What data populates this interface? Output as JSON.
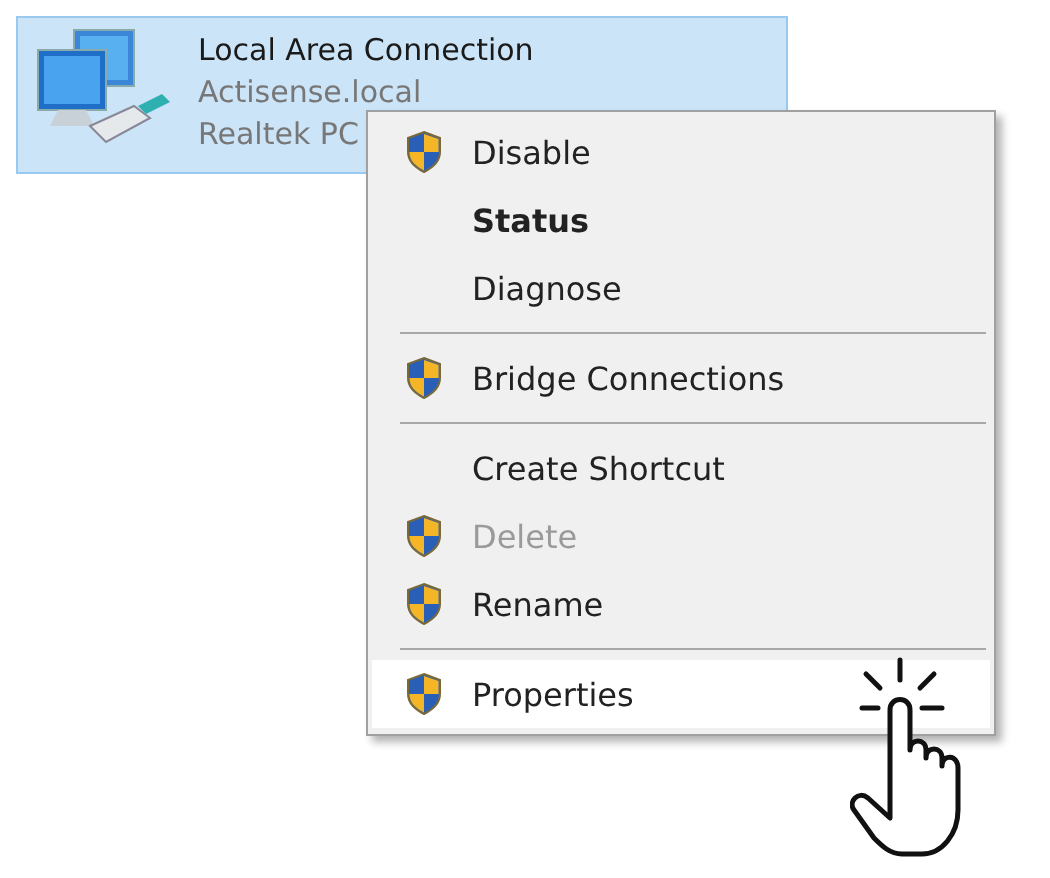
{
  "connection": {
    "name": "Local Area Connection",
    "lines": [
      "Actisense.local",
      "Realtek PC"
    ],
    "selected": true
  },
  "context_menu": {
    "items": [
      {
        "kind": "item",
        "label": "Disable",
        "shield": true,
        "default": false,
        "disabled": false,
        "selected": false
      },
      {
        "kind": "item",
        "label": "Status",
        "shield": false,
        "default": true,
        "disabled": false,
        "selected": false
      },
      {
        "kind": "item",
        "label": "Diagnose",
        "shield": false,
        "default": false,
        "disabled": false,
        "selected": false
      },
      {
        "kind": "separator"
      },
      {
        "kind": "item",
        "label": "Bridge Connections",
        "shield": true,
        "default": false,
        "disabled": false,
        "selected": false
      },
      {
        "kind": "separator"
      },
      {
        "kind": "item",
        "label": "Create Shortcut",
        "shield": false,
        "default": false,
        "disabled": false,
        "selected": false
      },
      {
        "kind": "item",
        "label": "Delete",
        "shield": true,
        "default": false,
        "disabled": true,
        "selected": false
      },
      {
        "kind": "item",
        "label": "Rename",
        "shield": true,
        "default": false,
        "disabled": false,
        "selected": false
      },
      {
        "kind": "separator"
      },
      {
        "kind": "item",
        "label": "Properties",
        "shield": true,
        "default": false,
        "disabled": false,
        "selected": true
      }
    ]
  }
}
